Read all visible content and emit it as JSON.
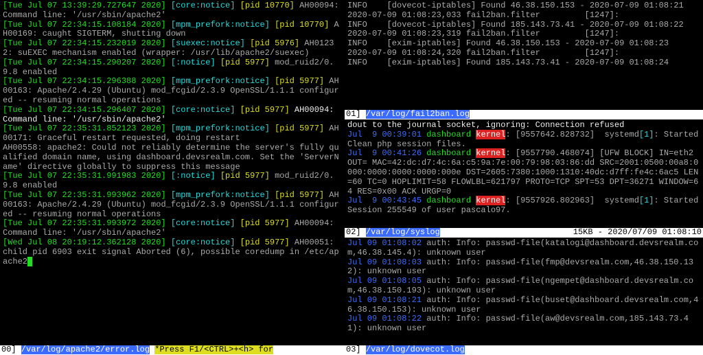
{
  "left": {
    "status_index": "00]",
    "status_path": "/var/log/apache2/error.log",
    "status_help": "*Press F1/<CTRL>+<h> for",
    "lines": [
      {
        "segs": [
          {
            "t": "[Tue Jul 07 13:39:29.727647 2020]",
            "c": "green"
          },
          {
            "t": " ",
            "c": "grey"
          },
          {
            "t": "[core:notice]",
            "c": "cyan"
          },
          {
            "t": " ",
            "c": "grey"
          },
          {
            "t": "[pid 10770]",
            "c": "yellow"
          },
          {
            "t": " AH00094: Command line: '/usr/sbin/apache2'",
            "c": "grey"
          }
        ]
      },
      {
        "segs": [
          {
            "t": "[Tue Jul 07 22:34:15.108184 2020]",
            "c": "green"
          },
          {
            "t": " ",
            "c": "grey"
          },
          {
            "t": "[mpm_prefork:notice]",
            "c": "cyan"
          },
          {
            "t": " ",
            "c": "grey"
          },
          {
            "t": "[pid 10770]",
            "c": "yellow"
          },
          {
            "t": " AH00169: caught SIGTERM, shutting down",
            "c": "grey"
          }
        ]
      },
      {
        "segs": [
          {
            "t": "[Tue Jul 07 22:34:15.232019 2020]",
            "c": "green"
          },
          {
            "t": " ",
            "c": "grey"
          },
          {
            "t": "[suexec:notice]",
            "c": "cyan"
          },
          {
            "t": " ",
            "c": "grey"
          },
          {
            "t": "[pid 5976]",
            "c": "yellow"
          },
          {
            "t": " AH01232: suEXEC mechanism enabled (wrapper: /usr/lib/apache2/suexec)",
            "c": "grey"
          }
        ]
      },
      {
        "segs": [
          {
            "t": "[Tue Jul 07 22:34:15.290207 2020]",
            "c": "green"
          },
          {
            "t": " ",
            "c": "grey"
          },
          {
            "t": "[:notice]",
            "c": "cyan"
          },
          {
            "t": " ",
            "c": "grey"
          },
          {
            "t": "[pid 5977]",
            "c": "yellow"
          },
          {
            "t": " mod_ruid2/0.9.8 enabled",
            "c": "grey"
          }
        ]
      },
      {
        "segs": [
          {
            "t": "[Tue Jul 07 22:34:15.296388 2020]",
            "c": "green"
          },
          {
            "t": " ",
            "c": "grey"
          },
          {
            "t": "[mpm_prefork:notice]",
            "c": "cyan"
          },
          {
            "t": " ",
            "c": "grey"
          },
          {
            "t": "[pid 5977]",
            "c": "yellow"
          },
          {
            "t": " AH00163: Apache/2.4.29 (Ubuntu) mod_fcgid/2.3.9 OpenSSL/1.1.1 configured -- resuming normal operations",
            "c": "grey"
          }
        ]
      },
      {
        "segs": [
          {
            "t": "[Tue Jul 07 22:34:15.296407 2020]",
            "c": "green"
          },
          {
            "t": " ",
            "c": "grey"
          },
          {
            "t": "[core:notice]",
            "c": "cyan"
          },
          {
            "t": " ",
            "c": "grey"
          },
          {
            "t": "[pid 5977]",
            "c": "yellow"
          },
          {
            "t": " AH00094: Command line: '/usr/sbin/apache2'",
            "c": "white"
          }
        ]
      },
      {
        "segs": [
          {
            "t": "[Tue Jul 07 22:35:31.852123 2020]",
            "c": "green"
          },
          {
            "t": " ",
            "c": "grey"
          },
          {
            "t": "[mpm_prefork:notice]",
            "c": "cyan"
          },
          {
            "t": " ",
            "c": "grey"
          },
          {
            "t": "[pid 5977]",
            "c": "yellow"
          },
          {
            "t": " AH00171: Graceful restart requested, doing restart",
            "c": "grey"
          }
        ]
      },
      {
        "segs": [
          {
            "t": "AH00558: apache2: Could not reliably determine the server's fully qualified domain name, using dashboard.devsrealm.com. Set the 'ServerName' directive globally to suppress this message",
            "c": "grey"
          }
        ]
      },
      {
        "segs": [
          {
            "t": "[Tue Jul 07 22:35:31.991983 2020]",
            "c": "green"
          },
          {
            "t": " ",
            "c": "grey"
          },
          {
            "t": "[:notice]",
            "c": "cyan"
          },
          {
            "t": " ",
            "c": "grey"
          },
          {
            "t": "[pid 5977]",
            "c": "yellow"
          },
          {
            "t": " mod_ruid2/0.9.8 enabled",
            "c": "grey"
          }
        ]
      },
      {
        "segs": [
          {
            "t": "[Tue Jul 07 22:35:31.993962 2020]",
            "c": "green"
          },
          {
            "t": " ",
            "c": "grey"
          },
          {
            "t": "[mpm_prefork:notice]",
            "c": "cyan"
          },
          {
            "t": " ",
            "c": "grey"
          },
          {
            "t": "[pid 5977]",
            "c": "yellow"
          },
          {
            "t": " AH00163: Apache/2.4.29 (Ubuntu) mod_fcgid/2.3.9 OpenSSL/1.1.1 configured -- resuming normal operations",
            "c": "grey"
          }
        ]
      },
      {
        "segs": [
          {
            "t": "[Tue Jul 07 22:35:31.993972 2020]",
            "c": "green"
          },
          {
            "t": " ",
            "c": "grey"
          },
          {
            "t": "[core:notice]",
            "c": "cyan"
          },
          {
            "t": " ",
            "c": "grey"
          },
          {
            "t": "[pid 5977]",
            "c": "yellow"
          },
          {
            "t": " AH00094: Command line: '/usr/sbin/apache2'",
            "c": "grey"
          }
        ]
      },
      {
        "segs": [
          {
            "t": "[Wed Jul 08 20:19:12.362128 2020]",
            "c": "green"
          },
          {
            "t": " ",
            "c": "grey"
          },
          {
            "t": "[core:notice]",
            "c": "cyan"
          },
          {
            "t": " ",
            "c": "grey"
          },
          {
            "t": "[pid 5977]",
            "c": "yellow"
          },
          {
            "t": " AH00051: child pid 6903 exit signal Aborted (6), possible coredump in /etc/apache2",
            "c": "grey"
          },
          {
            "t": " ",
            "c": "cursor"
          }
        ]
      }
    ]
  },
  "right": {
    "sec1": {
      "status_index": "01]",
      "status_path": "/var/log/fail2ban.log",
      "lines": [
        {
          "segs": [
            {
              "t": "INFO    [dovecot-iptables] Found 46.38.150.153 - 2020-07-09 01:08:21",
              "c": "grey"
            }
          ]
        },
        {
          "segs": [
            {
              "t": "2020-07-09 01:08:23,033 fail2ban.filter         [1247]:",
              "c": "grey"
            }
          ]
        },
        {
          "segs": [
            {
              "t": "INFO    [dovecot-iptables] Found 185.143.73.41 - 2020-07-09 01:08:22",
              "c": "grey"
            }
          ]
        },
        {
          "segs": [
            {
              "t": "2020-07-09 01:08:23,319 fail2ban.filter         [1247]:",
              "c": "grey"
            }
          ]
        },
        {
          "segs": [
            {
              "t": "INFO    [exim-iptables] Found 46.38.150.153 - 2020-07-09 01:08:23",
              "c": "grey"
            }
          ]
        },
        {
          "segs": [
            {
              "t": "2020-07-09 01:08:24,320 fail2ban.filter         [1247]:",
              "c": "grey"
            }
          ]
        },
        {
          "segs": [
            {
              "t": "INFO    [exim-iptables] Found 185.143.73.41 - 2020-07-09 01:08:24",
              "c": "grey"
            }
          ]
        }
      ]
    },
    "sec2": {
      "status_index": "02]",
      "status_path": "/var/log/syslog",
      "status_right": "15KB - 2020/07/09 01:08:10",
      "lines": [
        {
          "segs": [
            {
              "t": "dout to the journal socket, ignoring: Connection refused",
              "c": "white"
            }
          ]
        },
        {
          "segs": [
            {
              "t": "Jul  9 00:39:01",
              "c": "blue"
            },
            {
              "t": " dashboard ",
              "c": "green"
            },
            {
              "t": "kernel",
              "c": "red-bg"
            },
            {
              "t": ": [9557642.828732]  systemd",
              "c": "grey"
            },
            {
              "t": "[1]",
              "c": "cyan"
            },
            {
              "t": ": Started Clean php session files.",
              "c": "grey"
            }
          ]
        },
        {
          "segs": [
            {
              "t": "Jul  9 00:41:26",
              "c": "blue"
            },
            {
              "t": " dashboard ",
              "c": "green"
            },
            {
              "t": "kernel",
              "c": "red-bg"
            },
            {
              "t": ": [9557790.468074] [UFW BLOCK] IN=eth2 OUT= MAC=42:dc:d7:4c:6a:c5:9a:7e:00:79:98:03:86:dd SRC=2001:0500:00a8:0000:0000:0000:0000:000e DST=2605:7380:1000:1310:40dc:d7ff:fe4c:6ac5 LEN=60 TC=0 HOPLIMIT=58 FLOWLBL=621797 PROTO=TCP SPT=53 DPT=36271 WINDOW=64 RES=0x00 ACK URGP=0",
              "c": "grey"
            }
          ]
        },
        {
          "segs": [
            {
              "t": "Jul  9 00:43:45",
              "c": "blue"
            },
            {
              "t": " dashboard ",
              "c": "green"
            },
            {
              "t": "kernel",
              "c": "red-bg"
            },
            {
              "t": ": [9557926.802963]  systemd",
              "c": "grey"
            },
            {
              "t": "[1]",
              "c": "cyan"
            },
            {
              "t": ": Started Session 255549 of user pascalo97.",
              "c": "grey"
            }
          ]
        }
      ]
    },
    "sec3": {
      "status_index": "03]",
      "status_path": "/var/log/dovecot.log",
      "lines": [
        {
          "segs": [
            {
              "t": "Jul 09 01:08:02",
              "c": "blue"
            },
            {
              "t": " auth: Info: passwd-file(katalogi@dashboard.devsrealm.com,46.38.145.4): unknown user",
              "c": "grey"
            }
          ]
        },
        {
          "segs": [
            {
              "t": "Jul 09 01:08:03",
              "c": "blue"
            },
            {
              "t": " auth: Info: passwd-file(fmp@devsrealm.com,46.38.150.132): unknown user",
              "c": "grey"
            }
          ]
        },
        {
          "segs": [
            {
              "t": "Jul 09 01:08:05",
              "c": "blue"
            },
            {
              "t": " auth: Info: passwd-file(ngempet@dashboard.devsrealm.com,46.38.150.193): unknown user",
              "c": "grey"
            }
          ]
        },
        {
          "segs": [
            {
              "t": "Jul 09 01:08:21",
              "c": "blue"
            },
            {
              "t": " auth: Info: passwd-file(buset@dashboard.devsrealm.com,46.38.150.153): unknown user",
              "c": "grey"
            }
          ]
        },
        {
          "segs": [
            {
              "t": "Jul 09 01:08:22",
              "c": "blue"
            },
            {
              "t": " auth: Info: passwd-file(aw@devsrealm.com,185.143.73.41): unknown user",
              "c": "grey"
            }
          ]
        }
      ]
    }
  }
}
